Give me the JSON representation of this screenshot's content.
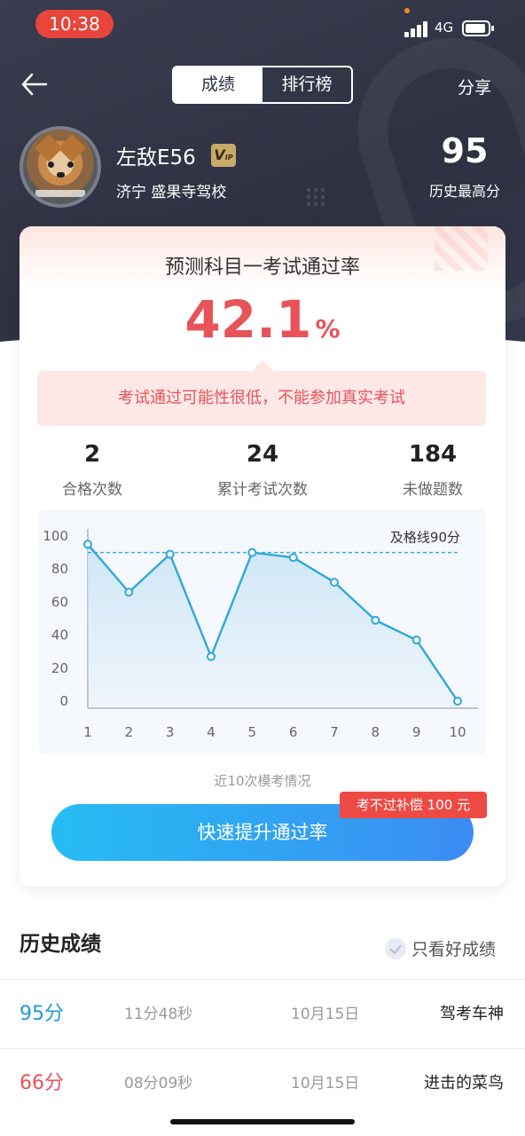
{
  "status_bar": {
    "time": "10:38",
    "network": "4G"
  },
  "nav": {
    "tabs": [
      {
        "label": "成绩",
        "active": true
      },
      {
        "label": "排行榜",
        "active": false
      }
    ],
    "share_label": "分享"
  },
  "profile": {
    "username": "左敌E56",
    "vip_badge": "V",
    "vip_badge_small": "IP",
    "city": "济宁",
    "school": "盛果寺驾校",
    "location": "济宁   盛果寺驾校",
    "best_score": "95",
    "best_label": "历史最高分"
  },
  "prediction": {
    "title": "预测科目一考试通过率",
    "rate": "42.1",
    "unit": "%",
    "warning": "考试通过可能性很低，不能参加真实考试"
  },
  "stats": [
    {
      "value": "2",
      "label": "合格次数"
    },
    {
      "value": "24",
      "label": "累计考试次数"
    },
    {
      "value": "184",
      "label": "未做题数"
    }
  ],
  "chart_data": {
    "type": "line",
    "x": [
      1,
      2,
      3,
      4,
      5,
      6,
      7,
      8,
      9,
      10
    ],
    "values": [
      95,
      66,
      89,
      27,
      90,
      87,
      72,
      49,
      37,
      0
    ],
    "ylim": [
      0,
      100
    ],
    "yticks": [
      0,
      20,
      40,
      60,
      80,
      100
    ],
    "pass_line": {
      "value": 90,
      "label": "及格线90分"
    },
    "caption": "近10次模考情况",
    "colors": {
      "line": "#2fa8dc",
      "fill": "#cde6f7",
      "pass_line": "#2fa8dc"
    }
  },
  "boost_button": {
    "label": "快速提升通过率",
    "tag": "考不过补偿 100 元"
  },
  "history": {
    "title": "历史成绩",
    "filter_label": "只看好成绩",
    "rows": [
      {
        "score": "95分",
        "duration": "11分48秒",
        "date": "10月15日",
        "rank": "驾考车神",
        "color": "#1f9ad6"
      },
      {
        "score": "66分",
        "duration": "08分09秒",
        "date": "10月15日",
        "rank": "进击的菜鸟",
        "color": "#e8535a"
      }
    ]
  }
}
